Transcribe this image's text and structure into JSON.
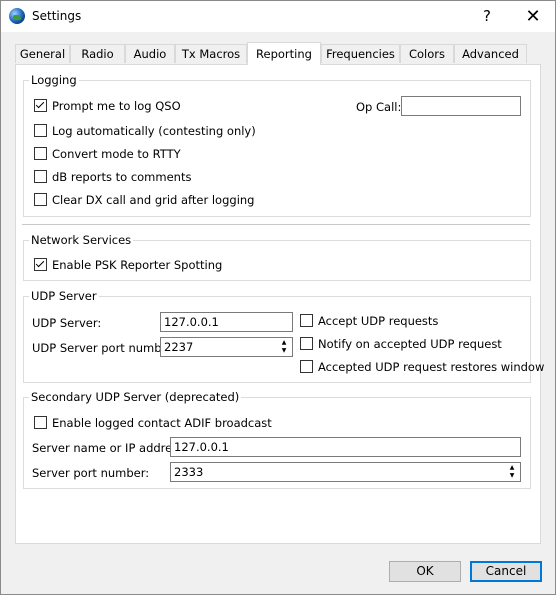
{
  "window": {
    "title": "Settings",
    "help_glyph": "?",
    "close_glyph": "✕"
  },
  "tabs": [
    {
      "label": "General"
    },
    {
      "label": "Radio"
    },
    {
      "label": "Audio"
    },
    {
      "label": "Tx Macros"
    },
    {
      "label": "Reporting",
      "active": true
    },
    {
      "label": "Frequencies"
    },
    {
      "label": "Colors"
    },
    {
      "label": "Advanced"
    }
  ],
  "logging": {
    "title": "Logging",
    "prompt_log_qso": {
      "label": "Prompt me to log QSO",
      "checked": true
    },
    "log_automatically": {
      "label": "Log automatically (contesting only)",
      "checked": false
    },
    "convert_mode": {
      "label": "Convert mode to RTTY",
      "checked": false
    },
    "db_reports": {
      "label": "dB reports to comments",
      "checked": false
    },
    "clear_dx": {
      "label": "Clear DX call and grid after logging",
      "checked": false
    },
    "op_call_label": "Op Call:",
    "op_call_value": ""
  },
  "network": {
    "title": "Network Services",
    "psk_reporter": {
      "label": "Enable PSK Reporter Spotting",
      "checked": true
    }
  },
  "udp": {
    "title": "UDP Server",
    "server_label": "UDP Server:",
    "server_value": "127.0.0.1",
    "port_label": "UDP Server port number:",
    "port_value": "2237",
    "accept_requests": {
      "label": "Accept UDP requests",
      "checked": false
    },
    "notify_accepted": {
      "label": "Notify on accepted UDP request",
      "checked": false
    },
    "restores_window": {
      "label": "Accepted UDP request restores window",
      "checked": false
    }
  },
  "secondary_udp": {
    "title": "Secondary UDP Server (deprecated)",
    "adif_broadcast": {
      "label": "Enable logged contact ADIF broadcast",
      "checked": false
    },
    "server_name_label": "Server name or IP address:",
    "server_name_value": "127.0.0.1",
    "port_label": "Server port number:",
    "port_value": "2333"
  },
  "buttons": {
    "ok": "OK",
    "cancel": "Cancel"
  }
}
